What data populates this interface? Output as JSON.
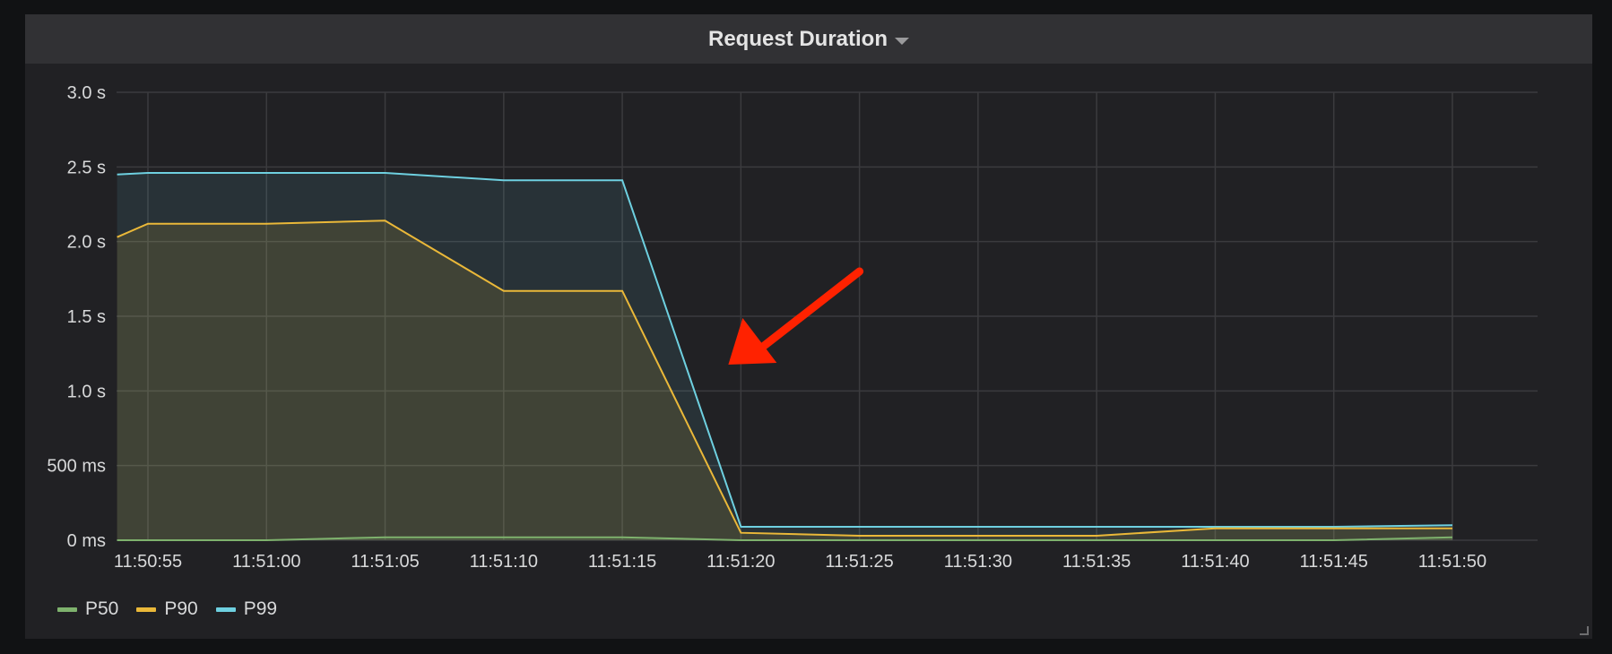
{
  "panel": {
    "title": "Request Duration"
  },
  "colors": {
    "P50": "#7eb26d",
    "P90": "#eab839",
    "P99": "#6ed0e0",
    "annotation": "#ff2200",
    "grid": "#3b3b3e"
  },
  "chart_data": {
    "type": "line",
    "title": "Request Duration",
    "xlabel": "",
    "ylabel": "",
    "x_ticks": [
      "11:50:55",
      "11:51:00",
      "11:51:05",
      "11:51:10",
      "11:51:15",
      "11:51:20",
      "11:51:25",
      "11:51:30",
      "11:51:35",
      "11:51:40",
      "11:51:45",
      "11:51:50"
    ],
    "y_ticks": [
      "3.0 s",
      "2.5 s",
      "2.0 s",
      "1.5 s",
      "1.0 s",
      "500 ms",
      "0 ms"
    ],
    "y_tick_values": [
      3.0,
      2.5,
      2.0,
      1.5,
      1.0,
      0.5,
      0
    ],
    "ylim": [
      0,
      3.0
    ],
    "x_units": "seconds",
    "grid": true,
    "legend_position": "bottom-left",
    "fill_area": true,
    "series": [
      {
        "name": "P50",
        "x": [
          "11:50:53.7",
          "11:50:55",
          "11:51:00",
          "11:51:05",
          "11:51:10",
          "11:51:15",
          "11:51:20",
          "11:51:25",
          "11:51:30",
          "11:51:35",
          "11:51:40",
          "11:51:45",
          "11:51:50"
        ],
        "values": [
          0.0,
          0.0,
          0.0,
          0.02,
          0.02,
          0.02,
          0.0,
          0.0,
          0.0,
          0.0,
          0.0,
          0.0,
          0.02
        ]
      },
      {
        "name": "P90",
        "x": [
          "11:50:53.7",
          "11:50:55",
          "11:51:00",
          "11:51:05",
          "11:51:10",
          "11:51:15",
          "11:51:20",
          "11:51:25",
          "11:51:30",
          "11:51:35",
          "11:51:40",
          "11:51:45",
          "11:51:50"
        ],
        "values": [
          2.03,
          2.12,
          2.12,
          2.14,
          1.67,
          1.67,
          0.05,
          0.03,
          0.03,
          0.03,
          0.08,
          0.08,
          0.08
        ]
      },
      {
        "name": "P99",
        "x": [
          "11:50:53.7",
          "11:50:55",
          "11:51:00",
          "11:51:05",
          "11:51:10",
          "11:51:15",
          "11:51:20",
          "11:51:25",
          "11:51:30",
          "11:51:35",
          "11:51:40",
          "11:51:45",
          "11:51:50"
        ],
        "values": [
          2.45,
          2.46,
          2.46,
          2.46,
          2.41,
          2.41,
          0.09,
          0.09,
          0.09,
          0.09,
          0.09,
          0.09,
          0.1
        ]
      }
    ],
    "annotation": {
      "type": "arrow",
      "color": "#ff2200",
      "from": [
        "11:51:25",
        1.8
      ],
      "to": [
        "11:51:20",
        1.2
      ]
    }
  }
}
